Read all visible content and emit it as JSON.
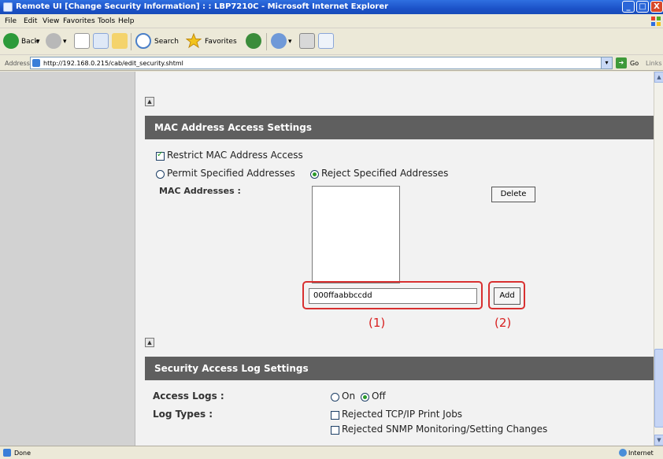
{
  "window": {
    "title": "Remote UI [Change Security Information] : : LBP7210C - Microsoft Internet Explorer",
    "minimize": "_",
    "maximize": "□",
    "close": "X"
  },
  "menu": [
    "File",
    "Edit",
    "View",
    "Favorites",
    "Tools",
    "Help"
  ],
  "toolbar": {
    "back": "Back",
    "search": "Search",
    "favorites": "Favorites"
  },
  "address": {
    "label": "Address",
    "url": "http://192.168.0.215/cab/edit_security.shtml",
    "go": "Go",
    "links": "Links"
  },
  "mac_section": {
    "header": "MAC Address Access Settings",
    "restrict_label": "Restrict MAC Address Access",
    "restrict_checked": true,
    "permit_label": "Permit Specified Addresses",
    "reject_label": "Reject Specified Addresses",
    "selected_mode": "reject",
    "addresses_label": "MAC Addresses :",
    "delete_button": "Delete",
    "input_value": "000ffaabbccdd",
    "add_button": "Add",
    "callout_1": "(1)",
    "callout_2": "(2)"
  },
  "log_section": {
    "header": "Security Access Log Settings",
    "access_logs_label": "Access Logs :",
    "on_label": "On",
    "off_label": "Off",
    "access_logs_value": "off",
    "log_types_label": "Log Types :",
    "log_types": [
      {
        "label": "Rejected TCP/IP Print Jobs",
        "checked": false
      },
      {
        "label": "Rejected SNMP Monitoring/Setting Changes",
        "checked": false
      }
    ]
  },
  "status": {
    "text": "Done",
    "zone": "Internet"
  },
  "colors": {
    "section_header": "#5f5f5f",
    "callout": "#d82020",
    "sidebar": "#d2d2d2",
    "title_bar": "#1c52c8"
  }
}
